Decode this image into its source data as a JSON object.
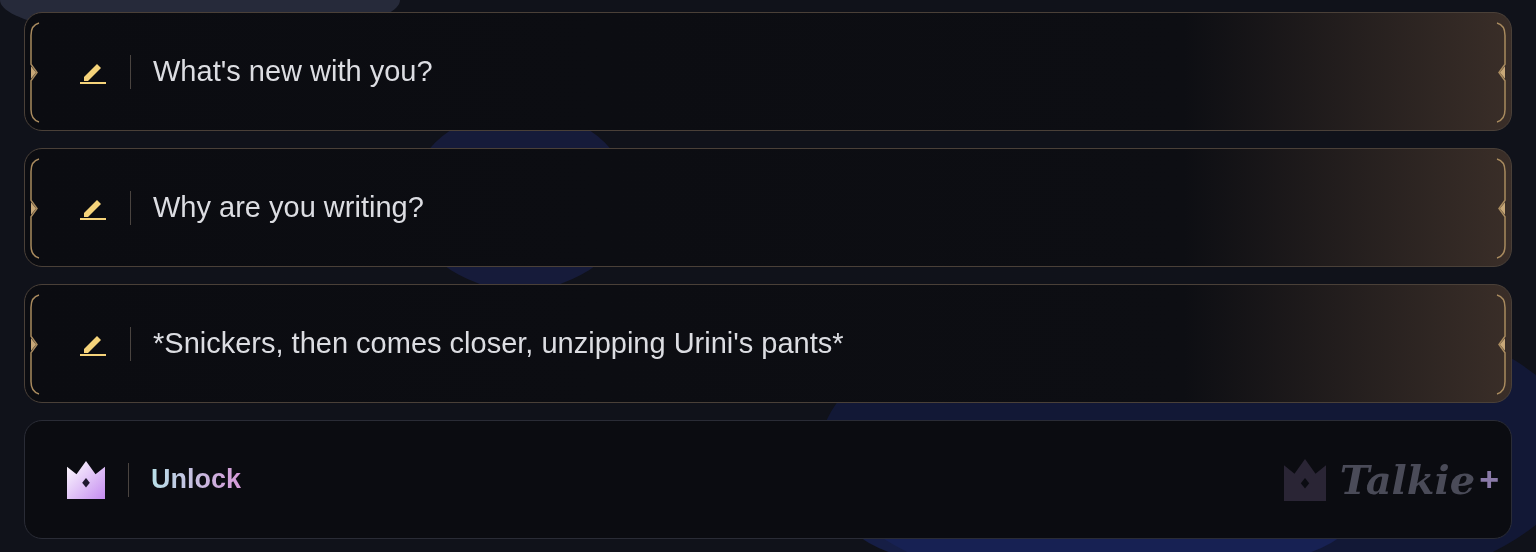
{
  "suggestions": [
    {
      "kind": "reply",
      "text": "What's new with you?"
    },
    {
      "kind": "reply",
      "text": "Why are you writing?"
    },
    {
      "kind": "reply",
      "text": "*Snickers, then comes closer, unzipping Urini's pants*"
    },
    {
      "kind": "unlock",
      "text": "Unlock",
      "brand": "Talkie",
      "brand_mark": "+"
    }
  ]
}
